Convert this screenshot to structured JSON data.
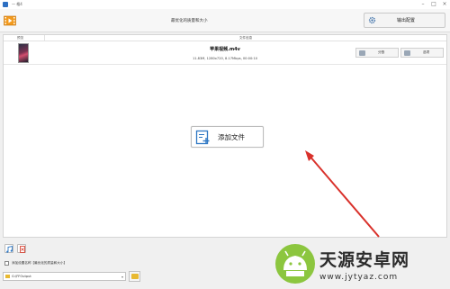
{
  "window": {
    "title": "一 格4",
    "controls": [
      "–",
      "□",
      "×"
    ]
  },
  "toolbar": {
    "center_text": "最优化的质量和大小",
    "output_settings_label": "输出配置"
  },
  "list": {
    "headers": {
      "preview": "预览",
      "file_info": "文件信息"
    },
    "rows": [
      {
        "name": "苹果视频.m4v",
        "meta": "11.83M, 1280x720, 8.17Mbps, 00:00:10",
        "cut_label": "分割",
        "options_label": "选项"
      }
    ]
  },
  "add_file_label": "添加文件",
  "bottom": {
    "checkbox_label": "添加设置名称【最优化的质量和大小】",
    "checkbox_checked": false,
    "output_path": "G:\\FFOutput"
  },
  "watermark": {
    "name": "天源安卓网",
    "url": "www.jytyaz.com"
  },
  "colors": {
    "arrow": "#d9312b",
    "logo_green": "#8cc63f",
    "accent_blue": "#2d6fc2"
  }
}
